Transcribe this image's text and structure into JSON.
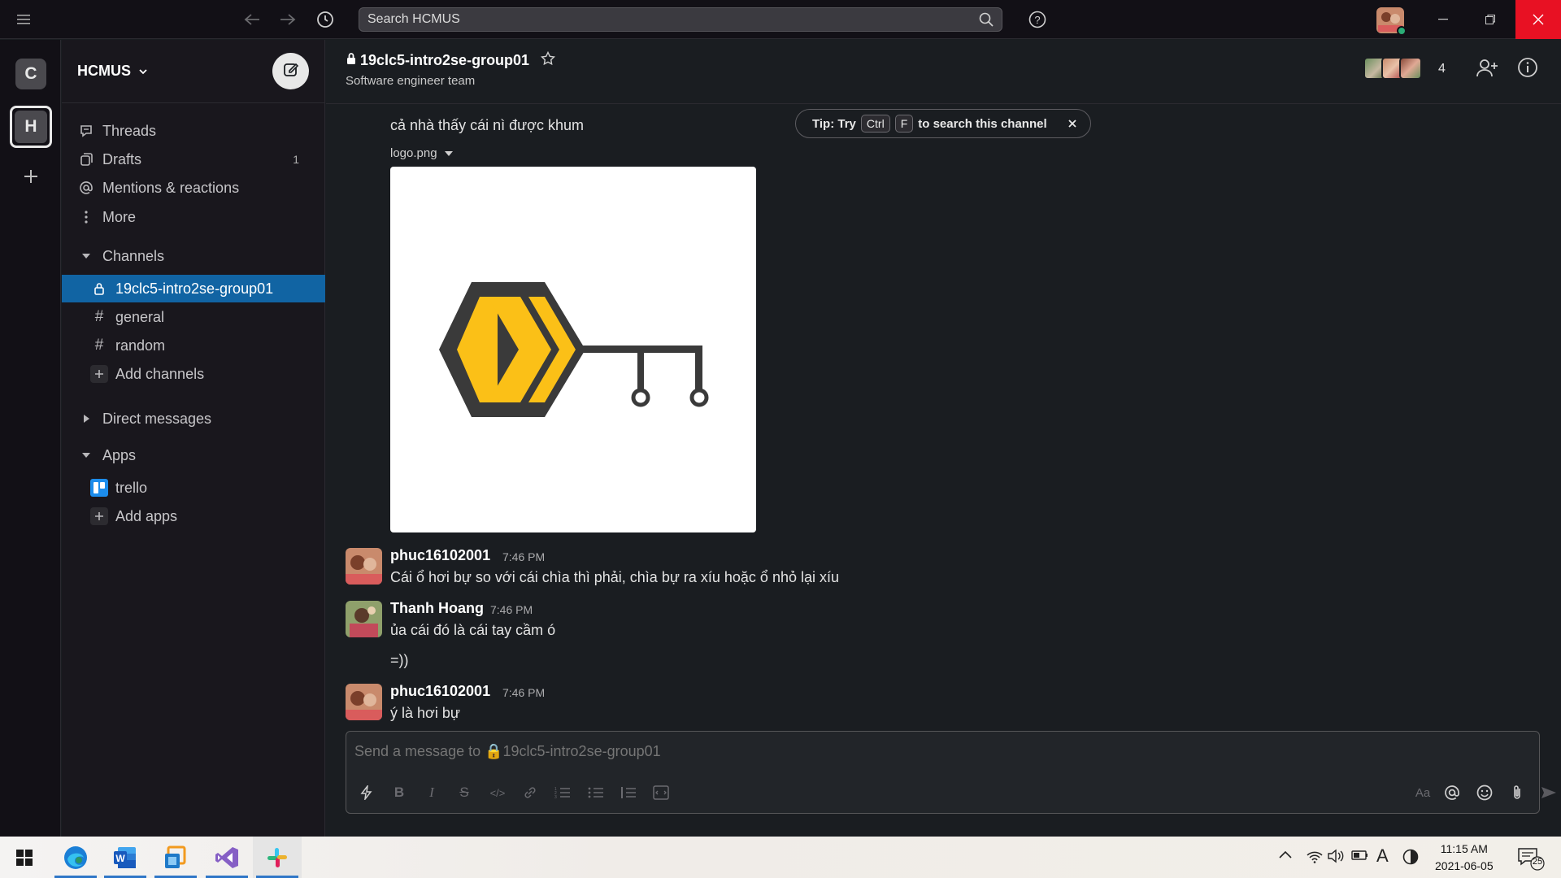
{
  "titlebar": {
    "search_placeholder": "Search HCMUS"
  },
  "rail": {
    "workspaces": [
      {
        "letter": "C",
        "active": false
      },
      {
        "letter": "H",
        "active": true
      }
    ],
    "add_label": "+"
  },
  "sidebar": {
    "workspace_name": "HCMUS",
    "nav": [
      {
        "label": "Threads",
        "icon": "threads-icon"
      },
      {
        "label": "Drafts",
        "icon": "drafts-icon",
        "badge": "1"
      },
      {
        "label": "Mentions & reactions",
        "icon": "at-icon"
      },
      {
        "label": "More",
        "icon": "more-vertical-icon"
      }
    ],
    "channels_header": "Channels",
    "channels": [
      {
        "label": "19clc5-intro2se-group01",
        "private": true,
        "selected": true
      },
      {
        "label": "general",
        "private": false
      },
      {
        "label": "random",
        "private": false
      }
    ],
    "add_channels": "Add channels",
    "direct_messages_header": "Direct messages",
    "apps_header": "Apps",
    "apps": [
      {
        "label": "trello"
      }
    ],
    "add_apps": "Add apps"
  },
  "channel": {
    "name": "19clc5-intro2se-group01",
    "topic": "Software engineer team",
    "member_count": "4"
  },
  "tip": {
    "prefix": "Tip: Try",
    "key1": "Ctrl",
    "key2": "F",
    "suffix": "to search this channel"
  },
  "messages": {
    "top_text": "cả nhà thấy cái nì được khum",
    "attachment_name": "logo.png",
    "items": [
      {
        "author": "phuc16102001",
        "time": "7:46 PM",
        "lines": [
          "Cái ổ hơi bự so với cái chìa thì phải, chìa bự ra xíu hoặc ổ nhỏ lại xíu"
        ]
      },
      {
        "author": "Thanh Hoang",
        "time": "7:46 PM",
        "lines": [
          "ủa cái đó là cái tay cầm ó",
          "=))"
        ]
      },
      {
        "author": "phuc16102001",
        "time": "7:46 PM",
        "lines": [
          "ý là hơi bự"
        ]
      }
    ]
  },
  "composer": {
    "placeholder": "Send a message to 🔒19clc5-intro2se-group01",
    "aa_label": "Aa"
  },
  "taskbar": {
    "time": "11:15 AM",
    "date": "2021-06-05",
    "input_indicator": "A",
    "notification_count": "25"
  },
  "colors": {
    "accent": "#1164a3",
    "close_red": "#e81123",
    "logo_yellow": "#fbc017",
    "logo_gray": "#3a3a3a"
  }
}
